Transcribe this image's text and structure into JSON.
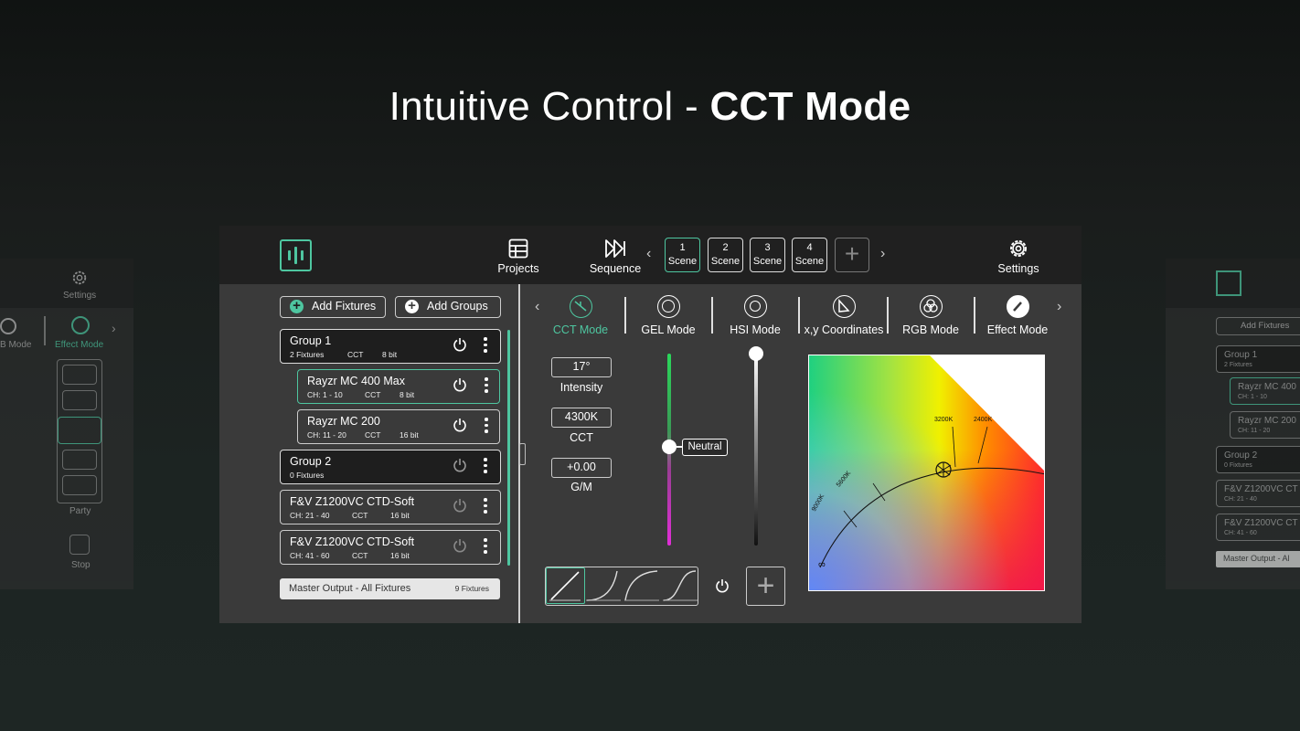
{
  "headline": {
    "light": "Intuitive Control - ",
    "bold": "CCT Mode"
  },
  "topbar": {
    "projects_label": "Projects",
    "sequence_label": "Sequence",
    "settings_label": "Settings",
    "scenes": [
      {
        "number": "1",
        "label": "Scene"
      },
      {
        "number": "2",
        "label": "Scene"
      },
      {
        "number": "3",
        "label": "Scene"
      },
      {
        "number": "4",
        "label": "Scene"
      }
    ],
    "active_scene": 1
  },
  "left_panel": {
    "add_fixtures": "Add Fixtures",
    "add_groups": "Add Groups",
    "rows": [
      {
        "name": "Group 1",
        "c1": "2 Fixtures",
        "c2": "CCT",
        "c3": "8 bit",
        "type": "group"
      },
      {
        "name": "Rayzr MC 400 Max",
        "c1": "CH: 1 - 10",
        "c2": "CCT",
        "c3": "8 bit",
        "type": "child-selected"
      },
      {
        "name": "Rayzr MC 200",
        "c1": "CH: 11 - 20",
        "c2": "CCT",
        "c3": "16 bit",
        "type": "child"
      },
      {
        "name": "Group 2",
        "c1": "0 Fixtures",
        "c2": "",
        "c3": "",
        "type": "group"
      },
      {
        "name": "F&V Z1200VC CTD-Soft",
        "c1": "CH: 21 - 40",
        "c2": "CCT",
        "c3": "16 bit",
        "type": "fixture"
      },
      {
        "name": "F&V Z1200VC CTD-Soft",
        "c1": "CH: 41 - 60",
        "c2": "CCT",
        "c3": "16 bit",
        "type": "fixture"
      }
    ],
    "master_label": "Master Output - All Fixtures",
    "master_count": "9 Fixtures"
  },
  "modes": [
    {
      "label": "CCT Mode",
      "icon": "cct-icon",
      "active": true
    },
    {
      "label": "GEL Mode",
      "icon": "gel-icon",
      "active": false
    },
    {
      "label": "HSI Mode",
      "icon": "hsi-icon",
      "active": false
    },
    {
      "label": "x,y Coordinates",
      "icon": "xy-icon",
      "active": false
    },
    {
      "label": "RGB Mode",
      "icon": "rgb-icon",
      "active": false
    },
    {
      "label": "Effect Mode",
      "icon": "effect-icon",
      "active": false
    }
  ],
  "values": {
    "intensity_value": "17°",
    "intensity_label": "Intensity",
    "cct_value": "4300K",
    "cct_label": "CCT",
    "gm_value": "+0.00",
    "gm_label": "G/M",
    "gm_slider_label": "Neutral"
  },
  "spectrum_labels": {
    "k3200": "3200K",
    "k2400": "2400K",
    "k5600": "5600K",
    "k9000": "9000K",
    "inf": "∞"
  },
  "ghost_left": {
    "settings": "Settings",
    "b_mode": "B Mode",
    "effect_mode": "Effect Mode",
    "party": "Party",
    "stop": "Stop"
  },
  "ghost_right": {
    "add_fixtures": "Add Fixtures",
    "rows": [
      {
        "name": "Group 1",
        "sub": "2 Fixtures"
      },
      {
        "name": "Rayzr MC 400",
        "sub": "CH: 1 - 10"
      },
      {
        "name": "Rayzr MC 200",
        "sub": "CH: 11 - 20"
      },
      {
        "name": "Group 2",
        "sub": "0 Fixtures"
      },
      {
        "name": "F&V Z1200VC CT",
        "sub": "CH: 21 - 40"
      },
      {
        "name": "F&V Z1200VC CT",
        "sub": "CH: 41 - 60"
      }
    ],
    "master": "Master Output - Al"
  },
  "colors": {
    "accent": "#4ec6a0",
    "panel": "#3a3a3a",
    "topbar": "#202020"
  }
}
